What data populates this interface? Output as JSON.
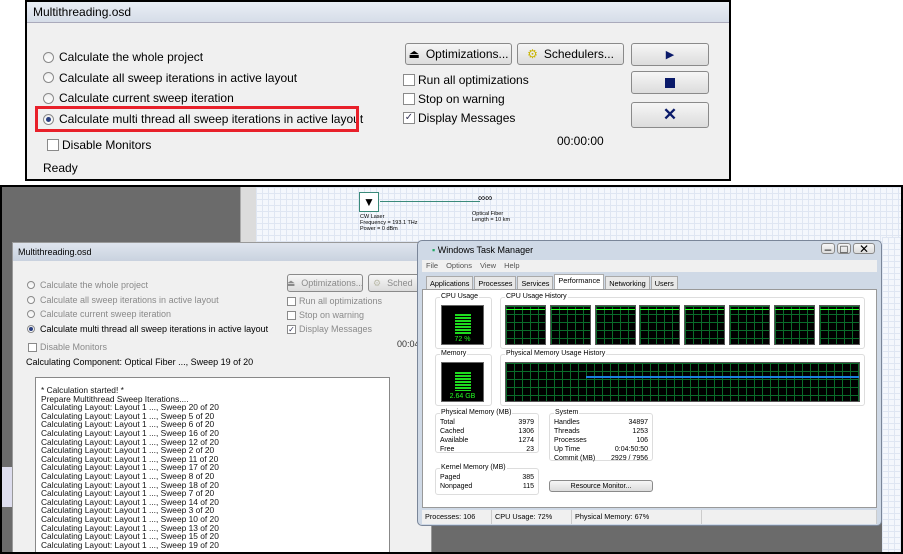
{
  "top_dialog": {
    "title": "Multithreading.osd",
    "radios": [
      {
        "label": "Calculate the whole project",
        "selected": false
      },
      {
        "label": "Calculate all sweep iterations in active layout",
        "selected": false
      },
      {
        "label": "Calculate current sweep iteration",
        "selected": false
      },
      {
        "label": "Calculate multi thread all sweep iterations in active layout",
        "selected": true
      }
    ],
    "disable_monitors": "Disable Monitors",
    "status": "Ready",
    "optimizations_button": "Optimizations...",
    "schedulers_button": "Schedulers...",
    "checks": [
      {
        "label": "Run all optimizations",
        "checked": false
      },
      {
        "label": "Stop on warning",
        "checked": false
      },
      {
        "label": "Display Messages",
        "checked": true
      }
    ],
    "timer": "00:00:00",
    "highlight_color": "#e8202a"
  },
  "schematic": {
    "laser": {
      "name": "CW Laser",
      "freq": "Frequency = 193.1  THz",
      "power": "Power = 0  dBm"
    },
    "fiber": {
      "name": "Optical Fiber",
      "length": "Length = 10  km"
    }
  },
  "bottom_dialog": {
    "title": "Multithreading.osd",
    "radios": [
      "Calculate the whole project",
      "Calculate all sweep iterations in active layout",
      "Calculate current sweep iteration",
      "Calculate multi thread all sweep iterations in active layout"
    ],
    "disable_monitors": "Disable Monitors",
    "optimizations_button": "Optimizations...",
    "schedulers_button": "Sched",
    "checks": [
      "Run all optimizations",
      "Stop on warning",
      "Display Messages"
    ],
    "timer": "00:04",
    "status": "Calculating Component: Optical Fiber ..., Sweep 19 of 20",
    "log": [
      "* Calculation started! *",
      "Prepare Multithread Sweep Iterations....",
      "Calculating Layout: Layout 1 ..., Sweep 20 of 20",
      "Calculating Layout: Layout 1 ..., Sweep 5 of 20",
      "Calculating Layout: Layout 1 ..., Sweep 6 of 20",
      "Calculating Layout: Layout 1 ..., Sweep 16 of 20",
      "Calculating Layout: Layout 1 ..., Sweep 12 of 20",
      "Calculating Layout: Layout 1 ..., Sweep 2 of 20",
      "Calculating Layout: Layout 1 ..., Sweep 11 of 20",
      "Calculating Layout: Layout 1 ..., Sweep 17 of 20",
      "Calculating Layout: Layout 1 ..., Sweep 8 of 20",
      "Calculating Layout: Layout 1 ..., Sweep 18 of 20",
      "Calculating Layout: Layout 1 ..., Sweep 7 of 20",
      "Calculating Layout: Layout 1 ..., Sweep 14 of 20",
      "Calculating Layout: Layout 1 ..., Sweep 3 of 20",
      "Calculating Layout: Layout 1 ..., Sweep 10 of 20",
      "Calculating Layout: Layout 1 ..., Sweep 13 of 20",
      "Calculating Layout: Layout 1 ..., Sweep 15 of 20",
      "Calculating Layout: Layout 1 ..., Sweep 19 of 20"
    ]
  },
  "task_manager": {
    "title": "Windows Task Manager",
    "menu": [
      "File",
      "Options",
      "View",
      "Help"
    ],
    "tabs": [
      "Applications",
      "Processes",
      "Services",
      "Performance",
      "Networking",
      "Users"
    ],
    "active_tab": "Performance",
    "cpu_usage_label": "CPU Usage",
    "cpu_usage": "72 %",
    "cpu_percent": 72,
    "cpu_history_label": "CPU Usage History",
    "cpu_cores": 8,
    "memory_label": "Memory",
    "memory_value": "2.64 GB",
    "memory_percent": 67,
    "mem_history_label": "Physical Memory Usage History",
    "physical": {
      "title": "Physical Memory (MB)",
      "rows": [
        [
          "Total",
          "3979"
        ],
        [
          "Cached",
          "1306"
        ],
        [
          "Available",
          "1274"
        ],
        [
          "Free",
          "23"
        ]
      ]
    },
    "kernel": {
      "title": "Kernel Memory (MB)",
      "rows": [
        [
          "Paged",
          "385"
        ],
        [
          "Nonpaged",
          "115"
        ]
      ]
    },
    "system": {
      "title": "System",
      "rows": [
        [
          "Handles",
          "34897"
        ],
        [
          "Threads",
          "1253"
        ],
        [
          "Processes",
          "106"
        ],
        [
          "Up Time",
          "0:04:50:50"
        ],
        [
          "Commit (MB)",
          "2929 / 7956"
        ]
      ]
    },
    "resource_monitor": "Resource Monitor...",
    "status": [
      "Processes: 106",
      "CPU Usage: 72%",
      "Physical Memory: 67%"
    ]
  }
}
